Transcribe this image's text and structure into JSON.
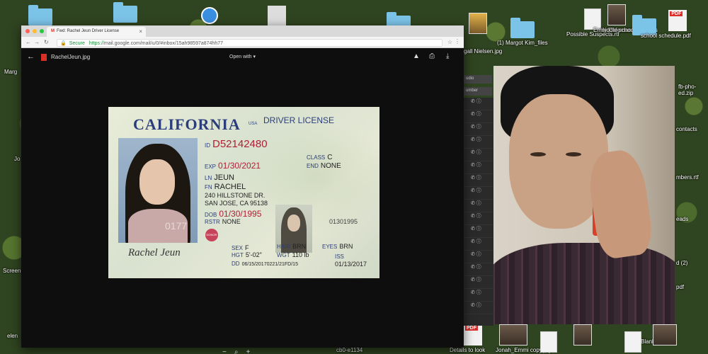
{
  "desktop": {
    "icons": [
      {
        "label": "Possible Suspects.rtf"
      },
      {
        "label": "Emily Coleman.jpg"
      },
      {
        "label": "middle school contacts"
      },
      {
        "label": "school schedule.pdf"
      },
      {
        "label": "(1) Margot Kim_files"
      },
      {
        "label": "gall Nielsen.jpg"
      }
    ],
    "edge_labels": [
      "Marg",
      "Jo",
      "Screen",
      "elen",
      "contacts",
      "mbers.rtf",
      "fb-pho-ed.zip",
      "eads",
      "d (2)",
      "pdf",
      "Details to look",
      "Jonah_Emmi copy.jpg",
      "cb0-e1134",
      "Blank"
    ]
  },
  "browser": {
    "tab_title": "Fwd: Rachel Jeun Driver License",
    "url_secure": "Secure",
    "url_scheme": "https://",
    "url_rest": "mail.google.com/mail/u/0/#inbox/15ah98597a874hh77"
  },
  "viewer": {
    "file_name": "RachelJeun.jpg",
    "open_with": "Open with ▾"
  },
  "license": {
    "state": "CALIFORNIA",
    "usa": "USA",
    "type": "DRIVER LICENSE",
    "id_label": "ID",
    "id": "D52142480",
    "exp_label": "EXP",
    "exp": "01/30/2021",
    "class_label": "CLASS",
    "class": "C",
    "end_label": "END",
    "end": "NONE",
    "ln_label": "LN",
    "ln": "JEUN",
    "fn_label": "FN",
    "fn": "RACHEL",
    "address1": "240 HILLSTONE DR.",
    "address2": "SAN JOSE, CA 95138",
    "dob_label": "DOB",
    "dob": "01/30/1995",
    "rstr_label": "RSTR",
    "rstr": "NONE",
    "ghost_number": "0177",
    "side_number": "01301995",
    "donor": "DONOR",
    "sex_label": "SEX",
    "sex": "F",
    "hair_label": "HAIR",
    "hair": "BRN",
    "eyes_label": "EYES",
    "eyes": "BRN",
    "hgt_label": "HGT",
    "hgt": "5'-02\"",
    "wgt_label": "WGT",
    "wgt": "110 lb",
    "dd_label": "DD",
    "dd": "06/15/20170221/21FD/15",
    "iss_label": "ISS",
    "iss": "01/13/2017",
    "signature": "Rachel Jeun"
  },
  "zoom": {
    "minus": "−",
    "icon": "⌕",
    "plus": "+"
  },
  "sidebar": {
    "head1": "udio",
    "head2": "umber"
  }
}
